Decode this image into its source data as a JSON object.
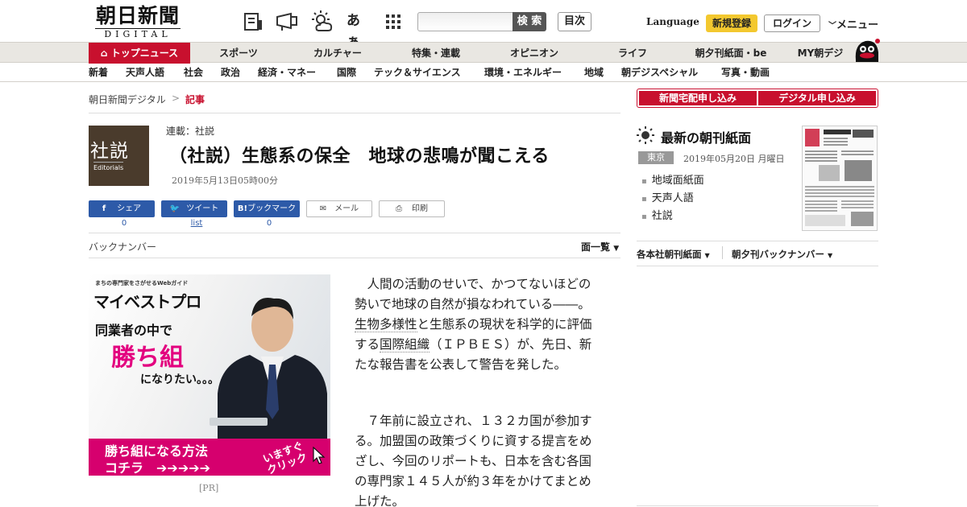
{
  "header": {
    "logo_kanji": "朝日新聞",
    "logo_digital": "DIGITAL",
    "icons": [
      "news-shortcut-icon",
      "megaphone-icon",
      "weather-icon",
      "font-size-icon",
      "grid-apps-icon"
    ],
    "font_icon_text": "あぁ",
    "search_placeholder": "",
    "search_label": "検 索",
    "toc_label": "目次",
    "language_label": "Language",
    "register_label": "新規登録",
    "login_label": "ログイン",
    "menu_label": "メニュー"
  },
  "nav1": {
    "items": [
      "トップニュース",
      "スポーツ",
      "カルチャー",
      "特集・連載",
      "オピニオン",
      "ライフ",
      "朝夕刊紙面・be",
      "MY朝デジ"
    ]
  },
  "nav2": {
    "items": [
      "新着",
      "天声人語",
      "社会",
      "政治",
      "経済・マネー",
      "国際",
      "テック＆サイエンス",
      "環境・エネルギー",
      "地域",
      "朝デジスペシャル",
      "写真・動画"
    ]
  },
  "breadcrumb": {
    "home": "朝日新聞デジタル",
    "sep": ">",
    "current": "記事"
  },
  "article": {
    "badge_jp": "社説",
    "badge_en": "Editorials",
    "series": "連載：社説",
    "title": "（社説）生態系の保全　地球の悲鳴が聞こえる",
    "date": "2019年5月13日05時00分",
    "share": [
      {
        "label": "シェア",
        "count": "0"
      },
      {
        "label": "ツイート",
        "count": "list"
      },
      {
        "label": "ブックマーク",
        "count": "0"
      },
      {
        "label": "メール",
        "count": ""
      },
      {
        "label": "印刷",
        "count": ""
      }
    ],
    "back_number": "バックナンバー",
    "page_list": "面一覧",
    "p1_a": "　人間の活動のせいで、かつてないほどの勢いで地球の自然が損なわれている――。",
    "p1_link1": "生物多様性",
    "p1_b": "と生態系の現状を科学的に評価する",
    "p1_link2": "国際組織",
    "p1_c": "（ＩＰＢＥＳ）が、先日、新たな報告書を公表して警告を発した。",
    "p2": "　７年前に設立され、１３２カ国が参加する。加盟国の政策づくりに資する提言をめざし、今回のリポートも、日本を含む各国の専門家１４５人が約３年をかけてまとめ上げた。"
  },
  "ad": {
    "tagline": "まちの専門家をさがせるWebガイド",
    "brand": "マイベストプロ",
    "line1": "同業者の中で",
    "line2": "勝ち組",
    "line3": "になりたい。。。",
    "bottom1": "勝ち組になる方法",
    "bottom2": "コチラ　➔➔➔➔➔",
    "click1": "いますぐ",
    "click2": "クリック",
    "pr": "[PR]"
  },
  "sidebar": {
    "btn1": "新聞宅配申し込み",
    "btn2": "デジタル申し込み",
    "paper_title": "最新の朝刊紙面",
    "region": "東京",
    "paper_date": "2019年05月20日 月曜日",
    "links": [
      "地域面紙面",
      "天声人語",
      "社説"
    ],
    "foot1": "各本社朝刊紙面",
    "foot2": "朝夕刊バックナンバー"
  },
  "colors": {
    "brand_red": "#c8102e",
    "share_blue": "#2d5aa8",
    "register_yellow": "#f3c82f",
    "nav_bg": "#e9e7e2"
  }
}
